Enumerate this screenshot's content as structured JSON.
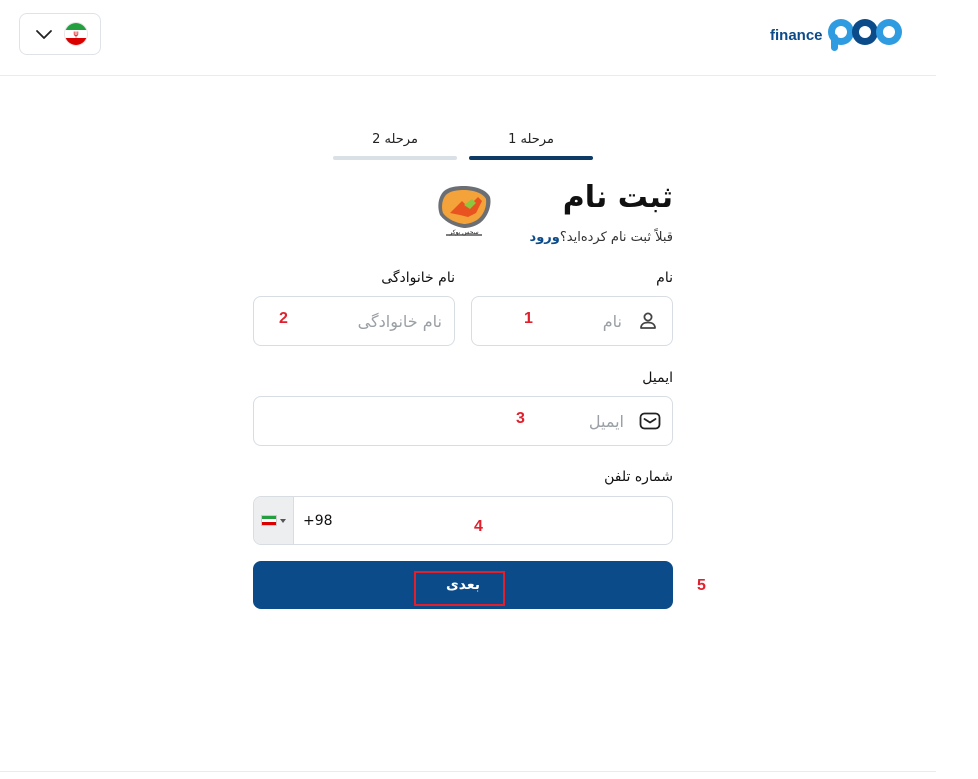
{
  "header": {
    "logo_text": "finance",
    "language_flag": "iran-flag-icon"
  },
  "stepper": {
    "step1_label": "مرحله 1",
    "step2_label": "مرحله 2",
    "active_step": 1
  },
  "form": {
    "title": "ثبت نام",
    "subtitle_prefix": "قبلاً ثبت نام کرده‌اید؟",
    "login_link": "ورود",
    "first_name_label": "نام",
    "first_name_placeholder": "نام",
    "last_name_label": "نام خانوادگی",
    "last_name_placeholder": "نام خانوادگی",
    "email_label": "ایمیل",
    "email_placeholder": "ایمیل",
    "phone_label": "شماره تلفن",
    "phone_dial_code": "+98",
    "phone_value": "",
    "submit_label": "بعدی"
  },
  "annotations": {
    "first_name": "1",
    "last_name": "2",
    "email": "3",
    "phone": "4",
    "submit": "5"
  },
  "colors": {
    "primary": "#0b4b8a",
    "step_active": "#0d3b66",
    "step_inactive": "#d9e0e6",
    "annotation": "#e0202c"
  }
}
